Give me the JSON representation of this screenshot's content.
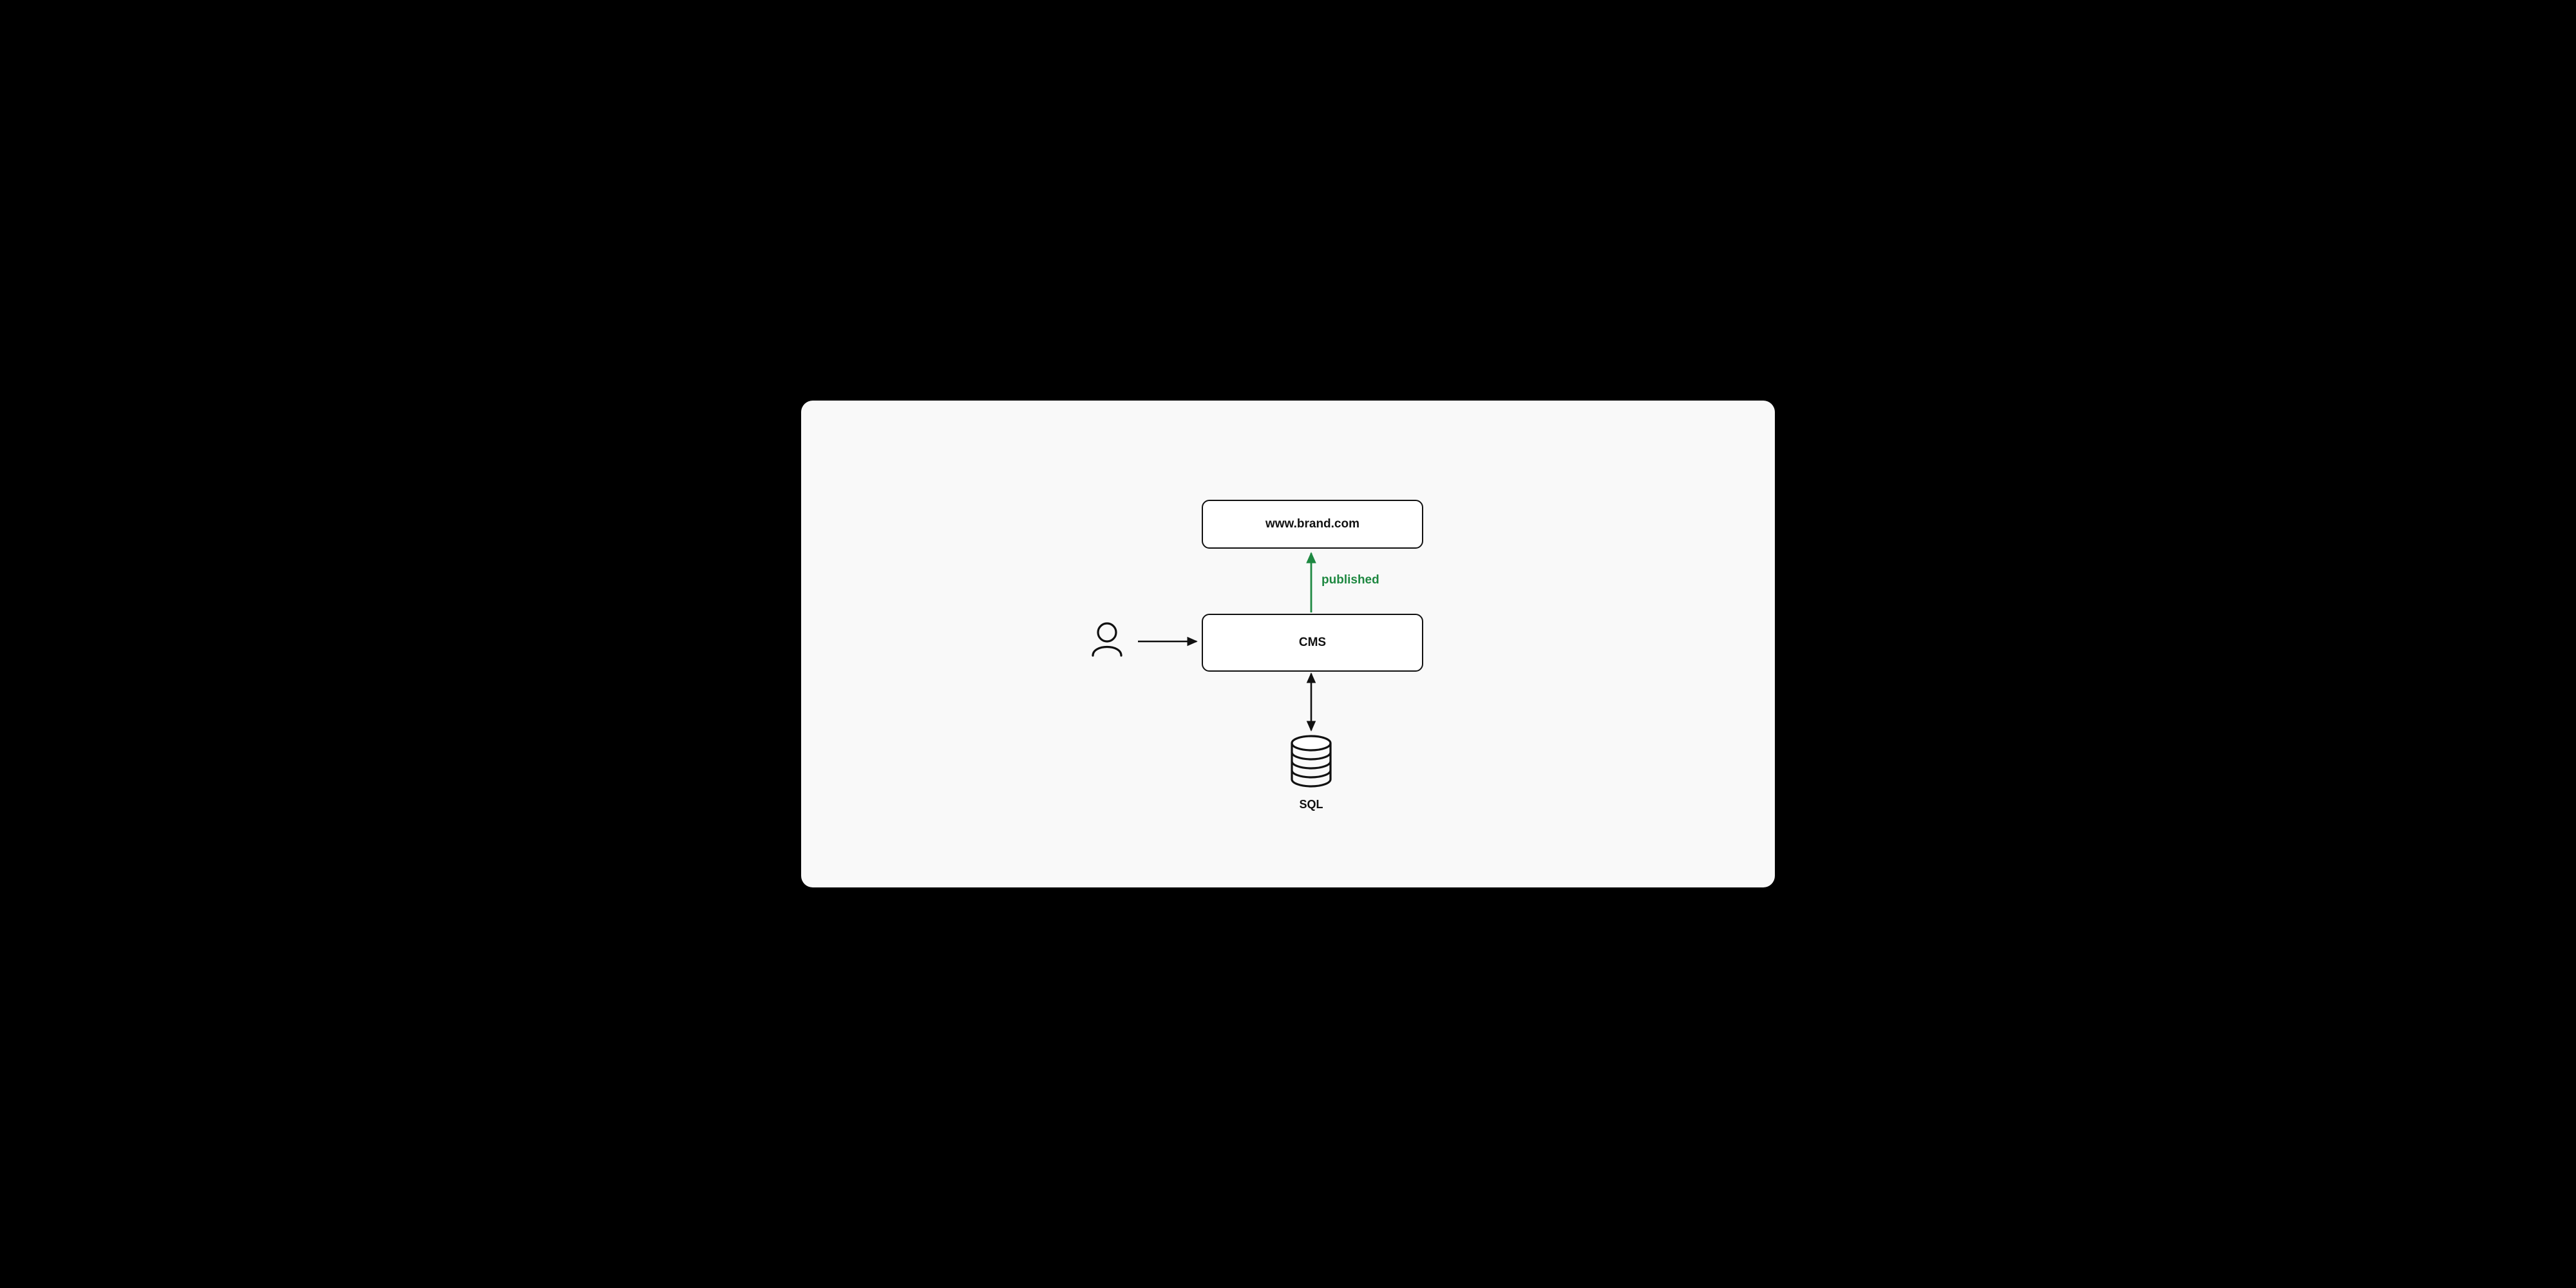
{
  "nodes": {
    "website": {
      "label": "www.brand.com"
    },
    "cms": {
      "label": "CMS"
    },
    "database": {
      "label": "SQL",
      "icon": "database-icon"
    },
    "user": {
      "icon": "user-icon"
    }
  },
  "edges": {
    "cms_to_website": {
      "label": "published",
      "color": "#1e8841",
      "direction": "up"
    },
    "user_to_cms": {
      "direction": "right"
    },
    "cms_to_database": {
      "direction": "bidirectional"
    }
  },
  "colors": {
    "stroke": "#111111",
    "accent": "#1e8841",
    "background": "#f9f9f9",
    "box_fill": "#ffffff"
  }
}
